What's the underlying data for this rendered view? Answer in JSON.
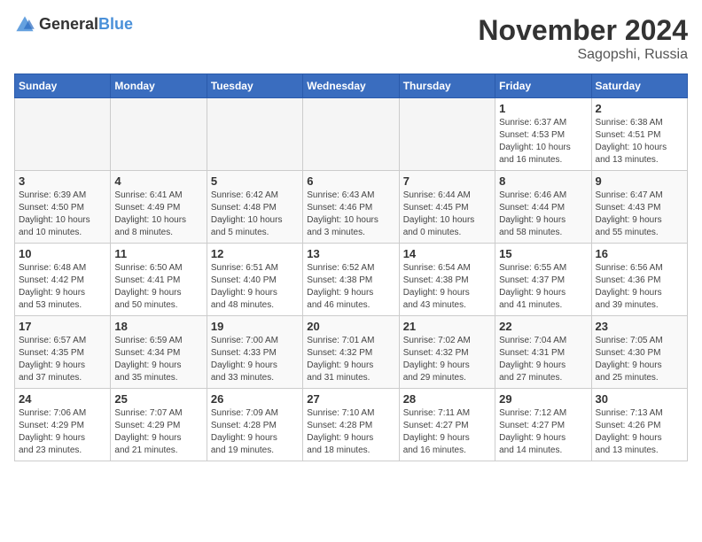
{
  "header": {
    "logo_general": "General",
    "logo_blue": "Blue",
    "month": "November 2024",
    "location": "Sagopshi, Russia"
  },
  "days_of_week": [
    "Sunday",
    "Monday",
    "Tuesday",
    "Wednesday",
    "Thursday",
    "Friday",
    "Saturday"
  ],
  "weeks": [
    [
      {
        "day": "",
        "info": ""
      },
      {
        "day": "",
        "info": ""
      },
      {
        "day": "",
        "info": ""
      },
      {
        "day": "",
        "info": ""
      },
      {
        "day": "",
        "info": ""
      },
      {
        "day": "1",
        "info": "Sunrise: 6:37 AM\nSunset: 4:53 PM\nDaylight: 10 hours\nand 16 minutes."
      },
      {
        "day": "2",
        "info": "Sunrise: 6:38 AM\nSunset: 4:51 PM\nDaylight: 10 hours\nand 13 minutes."
      }
    ],
    [
      {
        "day": "3",
        "info": "Sunrise: 6:39 AM\nSunset: 4:50 PM\nDaylight: 10 hours\nand 10 minutes."
      },
      {
        "day": "4",
        "info": "Sunrise: 6:41 AM\nSunset: 4:49 PM\nDaylight: 10 hours\nand 8 minutes."
      },
      {
        "day": "5",
        "info": "Sunrise: 6:42 AM\nSunset: 4:48 PM\nDaylight: 10 hours\nand 5 minutes."
      },
      {
        "day": "6",
        "info": "Sunrise: 6:43 AM\nSunset: 4:46 PM\nDaylight: 10 hours\nand 3 minutes."
      },
      {
        "day": "7",
        "info": "Sunrise: 6:44 AM\nSunset: 4:45 PM\nDaylight: 10 hours\nand 0 minutes."
      },
      {
        "day": "8",
        "info": "Sunrise: 6:46 AM\nSunset: 4:44 PM\nDaylight: 9 hours\nand 58 minutes."
      },
      {
        "day": "9",
        "info": "Sunrise: 6:47 AM\nSunset: 4:43 PM\nDaylight: 9 hours\nand 55 minutes."
      }
    ],
    [
      {
        "day": "10",
        "info": "Sunrise: 6:48 AM\nSunset: 4:42 PM\nDaylight: 9 hours\nand 53 minutes."
      },
      {
        "day": "11",
        "info": "Sunrise: 6:50 AM\nSunset: 4:41 PM\nDaylight: 9 hours\nand 50 minutes."
      },
      {
        "day": "12",
        "info": "Sunrise: 6:51 AM\nSunset: 4:40 PM\nDaylight: 9 hours\nand 48 minutes."
      },
      {
        "day": "13",
        "info": "Sunrise: 6:52 AM\nSunset: 4:38 PM\nDaylight: 9 hours\nand 46 minutes."
      },
      {
        "day": "14",
        "info": "Sunrise: 6:54 AM\nSunset: 4:38 PM\nDaylight: 9 hours\nand 43 minutes."
      },
      {
        "day": "15",
        "info": "Sunrise: 6:55 AM\nSunset: 4:37 PM\nDaylight: 9 hours\nand 41 minutes."
      },
      {
        "day": "16",
        "info": "Sunrise: 6:56 AM\nSunset: 4:36 PM\nDaylight: 9 hours\nand 39 minutes."
      }
    ],
    [
      {
        "day": "17",
        "info": "Sunrise: 6:57 AM\nSunset: 4:35 PM\nDaylight: 9 hours\nand 37 minutes."
      },
      {
        "day": "18",
        "info": "Sunrise: 6:59 AM\nSunset: 4:34 PM\nDaylight: 9 hours\nand 35 minutes."
      },
      {
        "day": "19",
        "info": "Sunrise: 7:00 AM\nSunset: 4:33 PM\nDaylight: 9 hours\nand 33 minutes."
      },
      {
        "day": "20",
        "info": "Sunrise: 7:01 AM\nSunset: 4:32 PM\nDaylight: 9 hours\nand 31 minutes."
      },
      {
        "day": "21",
        "info": "Sunrise: 7:02 AM\nSunset: 4:32 PM\nDaylight: 9 hours\nand 29 minutes."
      },
      {
        "day": "22",
        "info": "Sunrise: 7:04 AM\nSunset: 4:31 PM\nDaylight: 9 hours\nand 27 minutes."
      },
      {
        "day": "23",
        "info": "Sunrise: 7:05 AM\nSunset: 4:30 PM\nDaylight: 9 hours\nand 25 minutes."
      }
    ],
    [
      {
        "day": "24",
        "info": "Sunrise: 7:06 AM\nSunset: 4:29 PM\nDaylight: 9 hours\nand 23 minutes."
      },
      {
        "day": "25",
        "info": "Sunrise: 7:07 AM\nSunset: 4:29 PM\nDaylight: 9 hours\nand 21 minutes."
      },
      {
        "day": "26",
        "info": "Sunrise: 7:09 AM\nSunset: 4:28 PM\nDaylight: 9 hours\nand 19 minutes."
      },
      {
        "day": "27",
        "info": "Sunrise: 7:10 AM\nSunset: 4:28 PM\nDaylight: 9 hours\nand 18 minutes."
      },
      {
        "day": "28",
        "info": "Sunrise: 7:11 AM\nSunset: 4:27 PM\nDaylight: 9 hours\nand 16 minutes."
      },
      {
        "day": "29",
        "info": "Sunrise: 7:12 AM\nSunset: 4:27 PM\nDaylight: 9 hours\nand 14 minutes."
      },
      {
        "day": "30",
        "info": "Sunrise: 7:13 AM\nSunset: 4:26 PM\nDaylight: 9 hours\nand 13 minutes."
      }
    ]
  ]
}
